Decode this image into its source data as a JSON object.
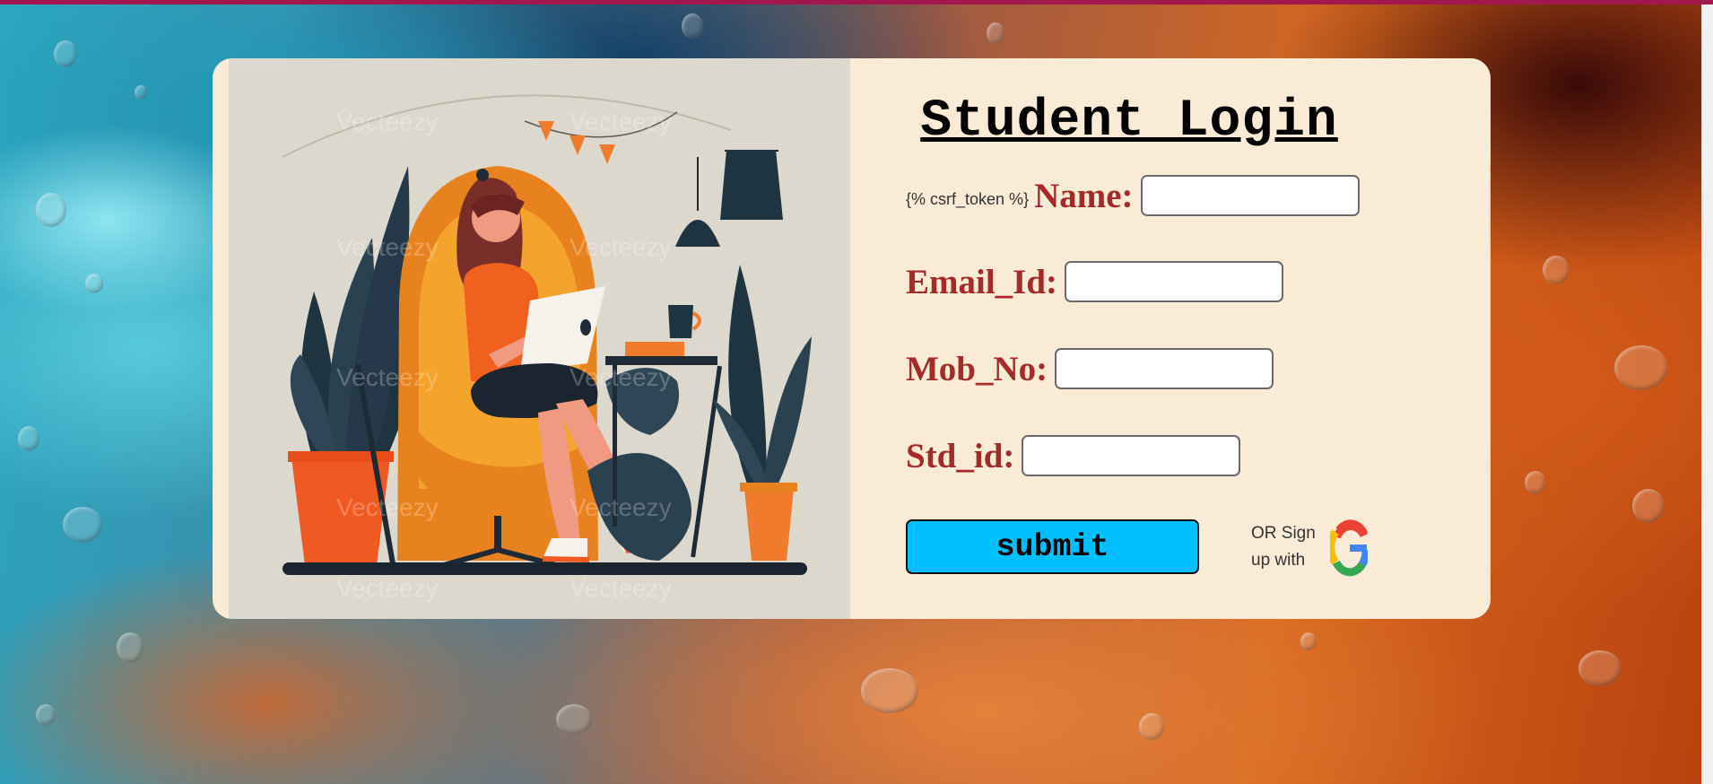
{
  "page": {
    "title": "Student Login"
  },
  "form": {
    "csrf_text": "{% csrf_token %}",
    "fields": [
      {
        "label": "Name:",
        "value": ""
      },
      {
        "label": "Email_Id:",
        "value": ""
      },
      {
        "label": "Mob_No:",
        "value": ""
      },
      {
        "label": "Std_id:",
        "value": ""
      }
    ],
    "submit_label": "submit",
    "or_sign_line1": "OR Sign",
    "or_sign_line2": "up with"
  },
  "illustration": {
    "watermark": "Vecteezy"
  },
  "colors": {
    "card": "#faebd7",
    "label": "#a52a2a",
    "submit": "#00bfff",
    "top_strip": "#a3174f"
  },
  "icons": [
    "google-icon"
  ]
}
